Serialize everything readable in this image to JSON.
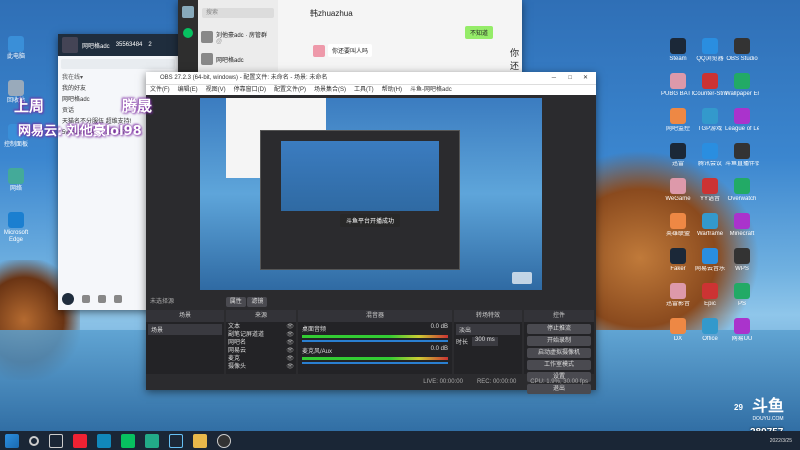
{
  "qq_window": {
    "title": "网吧格adc",
    "id_number": "35563484",
    "count": "2",
    "filter_label": "我在线▾",
    "group_items": [
      "我的好友",
      "网吧格adc",
      "贡话",
      "天猫名不分服伍 超维支持!",
      "5vs5vs5费朋友: 289757"
    ],
    "purple_label": "上周"
  },
  "wechat_window": {
    "search_placeholder": "搜索",
    "chats": [
      {
        "name": "刘他豪adc · 房管群",
        "preview": "@"
      },
      {
        "name": "网吧格adc",
        "preview": ""
      }
    ],
    "contact_name": "韩zhuazhua",
    "bubble_right": "不知道",
    "bubble_left": "你还要叫人吗"
  },
  "overlay": {
    "line1": "上周",
    "line1_right": "腾晟",
    "line2": "网易云: 刘他豪lol98"
  },
  "obs": {
    "title": "OBS 27.2.3 (64-bit, windows) - 配置文件: 未命名 - 场景: 未命名",
    "menu": [
      "文件(F)",
      "编辑(E)",
      "视图(V)",
      "停靠窗口(D)",
      "配置文件(P)",
      "场景集合(S)",
      "工具(T)",
      "帮助(H)",
      "斗鱼-网吧格adc"
    ],
    "no_source": "未选择源",
    "props_btn": "属性",
    "filters_btn": "滤镜",
    "panels": {
      "scenes": "场景",
      "sources": "来源",
      "mixer": "混音器",
      "transitions": "转场特效",
      "controls": "控件"
    },
    "scene_items": [
      "场景"
    ],
    "source_items": [
      "文本",
      "副笔记屏道道",
      "网吧名",
      "网易云",
      "麦克",
      "摄像头"
    ],
    "mixer_channels": [
      {
        "name": "桌面音频",
        "db": "0.0 dB"
      },
      {
        "name": "麦克风/Aux",
        "db": "0.0 dB"
      }
    ],
    "transition_select": "淡出",
    "duration_label": "时长",
    "duration_value": "300 ms",
    "controls": [
      "停止推流",
      "开始录制",
      "启动虚拟摄像机",
      "工作室模式",
      "设置",
      "退出"
    ],
    "status": {
      "live": "LIVE: 00:00:00",
      "rec": "REC: 00:00:00",
      "cpu": "CPU: 1.9%, 30.00 fps"
    },
    "inner_toast": "斗鱼平台开播成功"
  },
  "desktop_icons_right": [
    [
      "Steam",
      "QQ浏览器",
      "OBS Studio"
    ],
    [
      "PUBG BATTLEGR.",
      "Counter-Strike Global Off.",
      "Wallpaper Engine"
    ],
    [
      "网吧监控",
      "TGP游戏",
      "League of Legends"
    ],
    [
      "迅雷",
      "腾讯会议",
      "斗鱼直播伴侣"
    ],
    [
      "WeGame",
      "YY语音",
      "Overwatch"
    ],
    [
      "英雄联盟",
      "Warframe",
      "Minecraft"
    ],
    [
      "Faker",
      "网易云音乐",
      "WPS"
    ],
    [
      "迅雷影音",
      "Epic",
      "PS"
    ],
    [
      "DX",
      "Office",
      "网易UU"
    ]
  ],
  "desktop_icons_left": [
    "此电脑",
    "回收站",
    "控制面板",
    "网络",
    "Microsoft Edge"
  ],
  "watermark": {
    "logo": "斗鱼",
    "site": "DOUYU.COM",
    "room": "289757",
    "badge": "29"
  },
  "taskbar": {
    "time": "",
    "date": "2022/3/25"
  },
  "colors": {
    "accent_green": "#07c160",
    "douyu_orange": "#ff7e00",
    "obs_bg": "#2b2b2e"
  }
}
